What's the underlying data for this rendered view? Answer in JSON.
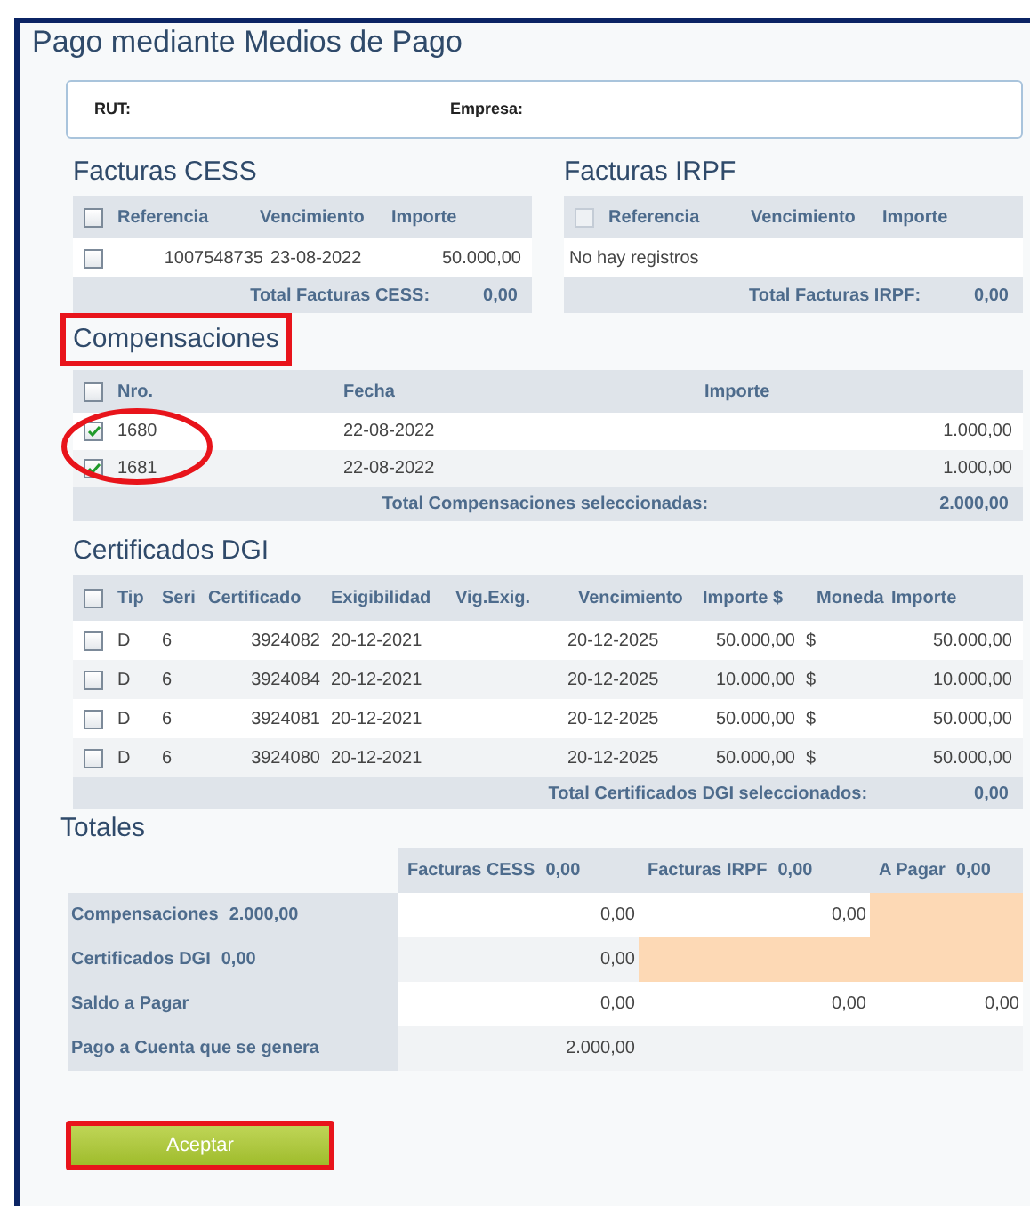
{
  "title": "Pago mediante Medios de Pago",
  "header_fields": [
    {
      "label": "RUT:"
    },
    {
      "label": "Empresa:"
    }
  ],
  "facturas_cess": {
    "heading": "Facturas CESS",
    "select_all": {
      "checked": false,
      "disabled": false
    },
    "columns": [
      "Referencia",
      "Vencimiento",
      "Importe"
    ],
    "rows": [
      {
        "checked": false,
        "cells": [
          "1007548735",
          "23-08-2022",
          "50.000,00"
        ]
      }
    ],
    "total_label": "Total Facturas CESS:",
    "total_value": "0,00"
  },
  "facturas_irpf": {
    "heading": "Facturas IRPF",
    "select_all": {
      "checked": false,
      "disabled": true
    },
    "columns": [
      "Referencia",
      "Vencimiento",
      "Importe"
    ],
    "empty_message": "No hay registros",
    "total_label": "Total Facturas IRPF:",
    "total_value": "0,00"
  },
  "compensaciones": {
    "heading": "Compensaciones",
    "select_all": {
      "checked": false
    },
    "columns": [
      "Nro.",
      "Fecha",
      "Importe"
    ],
    "rows": [
      {
        "checked": true,
        "cells": [
          "1680",
          "22-08-2022",
          "1.000,00"
        ]
      },
      {
        "checked": true,
        "cells": [
          "1681",
          "22-08-2022",
          "1.000,00"
        ]
      }
    ],
    "total_label": "Total Compensaciones seleccionadas:",
    "total_value": "2.000,00"
  },
  "certificados_dgi": {
    "heading": "Certificados DGI",
    "select_all": {
      "checked": false
    },
    "columns": [
      "Tip",
      "Seri",
      "Certificado",
      "Exigibilidad",
      "Vig.Exig.",
      "Vencimiento",
      "Importe $",
      "Moneda",
      "Importe"
    ],
    "rows": [
      {
        "checked": false,
        "cells": [
          "D",
          "6",
          "3924082",
          "20-12-2021",
          "",
          "20-12-2025",
          "50.000,00",
          "$",
          "50.000,00"
        ]
      },
      {
        "checked": false,
        "cells": [
          "D",
          "6",
          "3924084",
          "20-12-2021",
          "",
          "20-12-2025",
          "10.000,00",
          "$",
          "10.000,00"
        ]
      },
      {
        "checked": false,
        "cells": [
          "D",
          "6",
          "3924081",
          "20-12-2021",
          "",
          "20-12-2025",
          "50.000,00",
          "$",
          "50.000,00"
        ]
      },
      {
        "checked": false,
        "cells": [
          "D",
          "6",
          "3924080",
          "20-12-2021",
          "",
          "20-12-2025",
          "50.000,00",
          "$",
          "50.000,00"
        ]
      }
    ],
    "total_label": "Total Certificados DGI seleccionados:",
    "total_value": "0,00"
  },
  "totales": {
    "heading": "Totales",
    "columns": [
      {
        "label": "Facturas CESS",
        "value": "0,00"
      },
      {
        "label": "Facturas IRPF",
        "value": "0,00"
      },
      {
        "label": "A Pagar",
        "value": "0,00"
      }
    ],
    "rows": [
      {
        "label": "Compensaciones",
        "value": "2.000,00",
        "cells": [
          {
            "text": "0,00",
            "highlighted": false
          },
          {
            "text": "0,00",
            "highlighted": false
          },
          {
            "text": "",
            "highlighted": true
          }
        ]
      },
      {
        "label": "Certificados DGI",
        "value": "0,00",
        "cells": [
          {
            "text": "0,00",
            "highlighted": false
          },
          {
            "text": "",
            "highlighted": true
          },
          {
            "text": "",
            "highlighted": true
          }
        ]
      },
      {
        "label": "Saldo a Pagar",
        "cells": [
          {
            "text": "0,00",
            "highlighted": false
          },
          {
            "text": "0,00",
            "highlighted": false
          },
          {
            "text": "0,00",
            "highlighted": false
          }
        ]
      },
      {
        "label": "Pago a Cuenta que se genera",
        "cells": [
          {
            "text": "2.000,00",
            "highlighted": false
          },
          {
            "text": "",
            "highlighted": false
          },
          {
            "text": "",
            "highlighted": false
          }
        ]
      }
    ]
  },
  "accept_button": "Aceptar"
}
